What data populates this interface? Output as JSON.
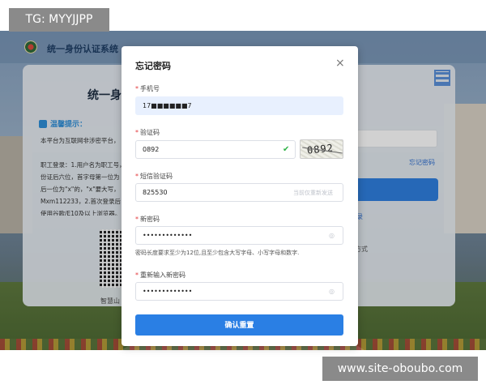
{
  "watermarks": {
    "top_left": "TG: MYYJJPP",
    "bottom_right": "www.site-oboubo.com"
  },
  "header": {
    "title": "统一身份认证系统"
  },
  "login_card": {
    "heading_left": "统一身份",
    "heading_right": "录",
    "tip_title": "温馨提示：",
    "tip_lines": [
      "本平台为互联网非涉密平台，",
      "",
      "职工登录：1.用户名为职工号，",
      "份证后六位，首字母第一位为",
      "后一位为\"x\"的，\"x\"要大写，",
      "Mxm112233，2.首次登录后，",
      "使用谷歌/E10及以上浏览器。"
    ],
    "qr_caption": "智慧山",
    "forgot_link": "忘记密码",
    "right_small": "录",
    "right_small2": "方式"
  },
  "modal": {
    "title": "忘记密码",
    "close_glyph": "×",
    "phone": {
      "label": "手机号",
      "value": "17■■■■■■7"
    },
    "captcha": {
      "label": "验证码",
      "value": "0892",
      "image_text": "0892",
      "check_glyph": "✔"
    },
    "sms": {
      "label": "短信验证码",
      "value": "825530",
      "send_label": "当前仅重新发送"
    },
    "new_password": {
      "label": "新密码",
      "value": "•••••••••••••",
      "hint": "密码长度要求至少为12位,且至少包含大写字母、小写字母和数字."
    },
    "confirm_password": {
      "label": "重新输入新密码",
      "value": "•••••••••••••"
    },
    "eye_glyph": "◎",
    "submit_label": "确认重置",
    "required_mark": "*"
  },
  "colors": {
    "primary": "#2a7fe4",
    "required": "#e4393c",
    "success": "#2fb347"
  }
}
